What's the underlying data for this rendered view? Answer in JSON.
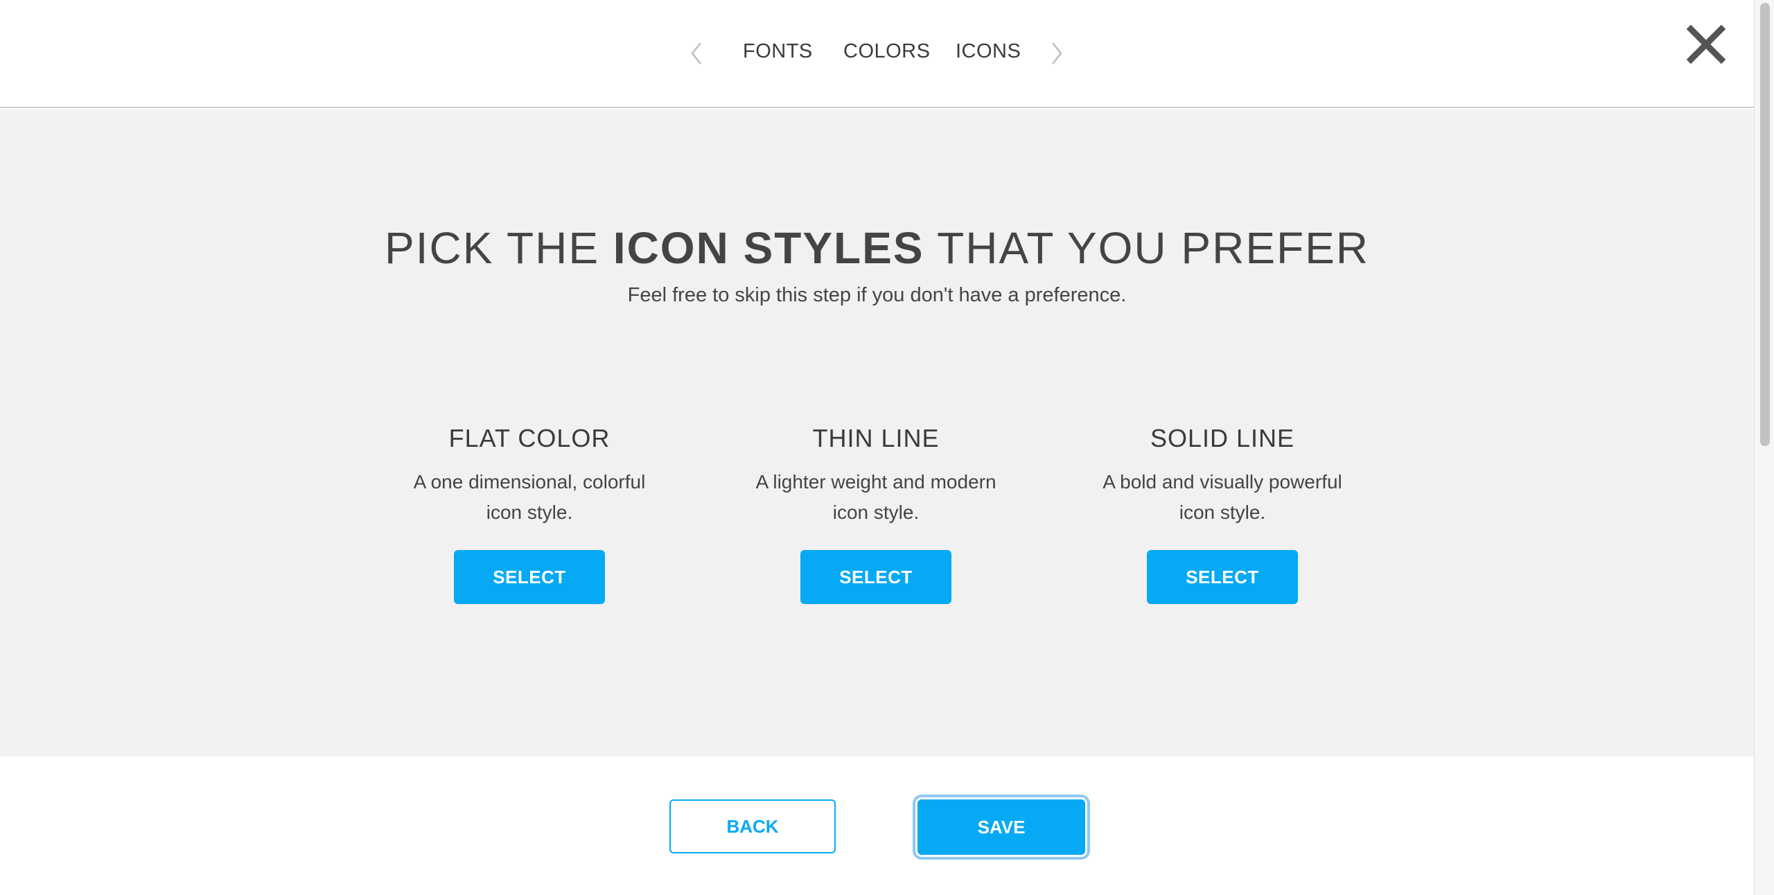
{
  "nav": {
    "prev_icon": "chevron-left-icon",
    "next_icon": "chevron-right-icon",
    "tabs": [
      {
        "label": "FONTS"
      },
      {
        "label": "COLORS"
      },
      {
        "label": "ICONS"
      }
    ],
    "close_icon": "close-icon"
  },
  "header": {
    "title_prefix": "PICK THE ",
    "title_emphasis": "ICON STYLES",
    "title_suffix": " THAT YOU PREFER",
    "subtitle": "Feel free to skip this step if you don't have a preference."
  },
  "options": [
    {
      "title": "FLAT COLOR",
      "description": "A one dimensional, colorful icon style.",
      "button": "SELECT"
    },
    {
      "title": "THIN LINE",
      "description": "A lighter weight and modern icon style.",
      "button": "SELECT"
    },
    {
      "title": "SOLID LINE",
      "description": "A bold and visually powerful icon style.",
      "button": "SELECT"
    }
  ],
  "footer": {
    "back_label": "BACK",
    "save_label": "SAVE"
  },
  "colors": {
    "accent": "#06a9f4",
    "background_gray": "#f1f1f1",
    "text": "#444444"
  }
}
